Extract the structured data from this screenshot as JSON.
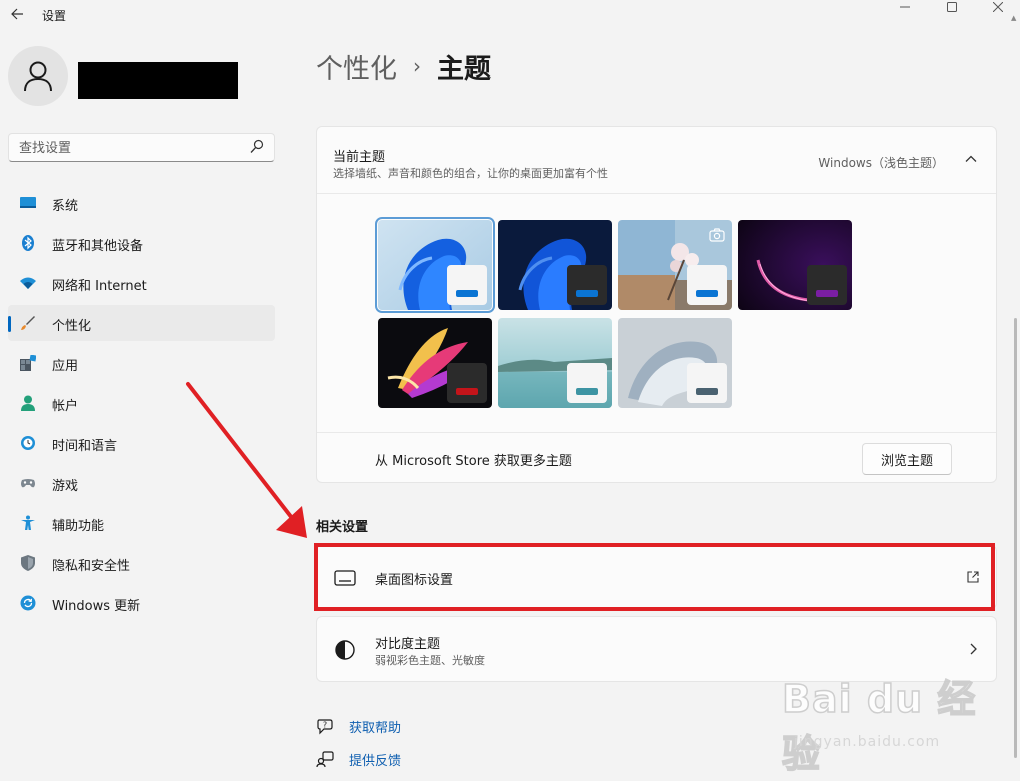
{
  "app": {
    "title": "设置"
  },
  "search": {
    "placeholder": "查找设置"
  },
  "nav": {
    "items": [
      {
        "label": "系统",
        "icon": "display-icon",
        "active": false
      },
      {
        "label": "蓝牙和其他设备",
        "icon": "bluetooth-icon",
        "active": false
      },
      {
        "label": "网络和 Internet",
        "icon": "wifi-icon",
        "active": false
      },
      {
        "label": "个性化",
        "icon": "brush-icon",
        "active": true
      },
      {
        "label": "应用",
        "icon": "apps-icon",
        "active": false
      },
      {
        "label": "帐户",
        "icon": "account-icon",
        "active": false
      },
      {
        "label": "时间和语言",
        "icon": "globe-clock-icon",
        "active": false
      },
      {
        "label": "游戏",
        "icon": "gamepad-icon",
        "active": false
      },
      {
        "label": "辅助功能",
        "icon": "accessibility-icon",
        "active": false
      },
      {
        "label": "隐私和安全性",
        "icon": "shield-icon",
        "active": false
      },
      {
        "label": "Windows 更新",
        "icon": "update-icon",
        "active": false
      }
    ]
  },
  "breadcrumb": {
    "parent": "个性化",
    "separator": "›",
    "current": "主题"
  },
  "current_theme": {
    "title": "当前主题",
    "description": "选择墙纸、声音和颜色的组合，让你的桌面更加富有个性",
    "value": "Windows（浅色主题）",
    "themes": [
      {
        "name": "windows-light",
        "selected": true,
        "accent": "#0a74d3"
      },
      {
        "name": "windows-dark",
        "selected": false,
        "accent": "#0a74d3"
      },
      {
        "name": "spotlight",
        "selected": false,
        "accent": "#0a74d3"
      },
      {
        "name": "glow",
        "selected": false,
        "accent": "#7a1ea3"
      },
      {
        "name": "captured-motion",
        "selected": false,
        "accent": "#c4141a"
      },
      {
        "name": "sunrise",
        "selected": false,
        "accent": "#3d94a3"
      },
      {
        "name": "flow",
        "selected": false,
        "accent": "#4a6271"
      }
    ]
  },
  "store": {
    "text": "从 Microsoft Store 获取更多主题",
    "button_label": "浏览主题"
  },
  "related": {
    "heading": "相关设置",
    "desktop_icons": {
      "title": "桌面图标设置"
    },
    "contrast": {
      "title": "对比度主题",
      "subtitle": "弱视彩色主题、光敏度"
    }
  },
  "help": {
    "get_help": "获取帮助",
    "feedback": "提供反馈"
  },
  "watermark": {
    "logo": "Bai du 经验",
    "url": "jingyan.baidu.com"
  },
  "colors": {
    "accent": "#0067c0",
    "highlight": "#e02024",
    "link": "#0f5fb0"
  }
}
